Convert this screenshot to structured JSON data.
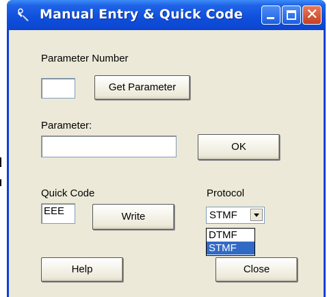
{
  "window": {
    "title": "Manual Entry & Quick Code"
  },
  "labels": {
    "parameter_number": "Parameter Number",
    "parameter": "Parameter:",
    "quick_code": "Quick Code",
    "protocol": "Protocol"
  },
  "fields": {
    "parameter_number_value": "",
    "parameter_value": "",
    "quick_code_value": "EEE"
  },
  "buttons": {
    "get_parameter": "Get Parameter",
    "ok": "OK",
    "write": "Write",
    "help": "Help",
    "close": "Close"
  },
  "protocol": {
    "selected": "STMF",
    "options": [
      "DTMF",
      "STMF"
    ],
    "highlighted": "STMF"
  },
  "icons": [
    "app-icon",
    "minimize-icon",
    "maximize-icon",
    "close-icon",
    "chevron-down-icon"
  ],
  "colors": {
    "titlebar": "#0f4fdc",
    "client": "#ece9d8",
    "highlight": "#316ac5",
    "close_button": "#c5401f"
  }
}
